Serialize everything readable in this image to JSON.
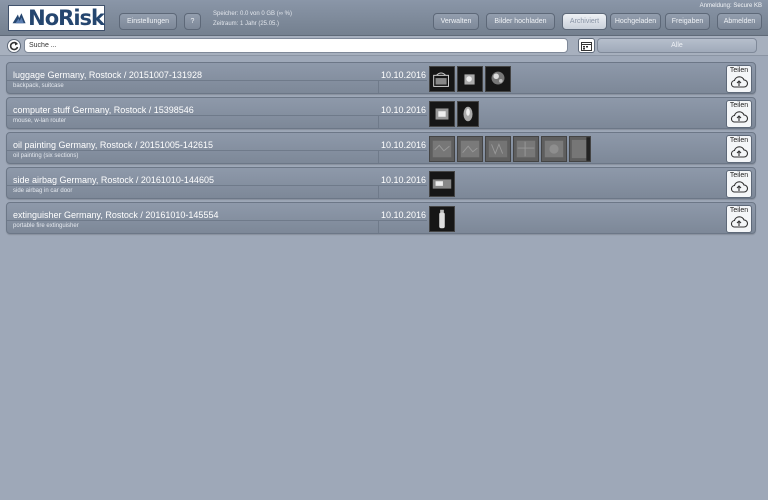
{
  "header": {
    "logo_text": "NoRisk",
    "btn_settings": "Einstellungen",
    "btn_help": "?",
    "storage": "Speicher: 0.0 von 0 GB (∞ %)",
    "period": "Zeitraum: 1 Jahr (25.05.)",
    "btn_manage": "Verwalten",
    "btn_upload": "Bilder hochladen",
    "tabs": [
      "Archiviert",
      "Hochgeladen",
      "Freigaben"
    ],
    "active_tab": "Archiviert",
    "btn_logout": "Abmelden",
    "login": "Anmeldung: Secure KB"
  },
  "search": {
    "placeholder": "Suche ...",
    "filter": "Alle"
  },
  "share_label": "Teilen",
  "items": [
    {
      "title": "luggage Germany, Rostock / 20151007-131928",
      "subtitle": "backpack, suitcase",
      "date": "10.10.2016",
      "thumbnails": 3
    },
    {
      "title": "computer stuff Germany, Rostock / 15398546",
      "subtitle": "mouse, w-lan router",
      "date": "10.10.2016",
      "thumbnails": 2
    },
    {
      "title": "oil painting Germany, Rostock / 20151005-142615",
      "subtitle": "oil painting (six sections)",
      "date": "10.10.2016",
      "thumbnails": 6
    },
    {
      "title": "side airbag Germany, Rostock / 20161010-144605",
      "subtitle": "side airbag in car door",
      "date": "10.10.2016",
      "thumbnails": 1
    },
    {
      "title": "extinguisher Germany, Rostock / 20161010-145554",
      "subtitle": "portable fire extinguisher",
      "date": "10.10.2016",
      "thumbnails": 1
    }
  ],
  "colors": {
    "background": "#9ea8b8",
    "header": "#7d8898",
    "logo_blue": "#25466f"
  }
}
